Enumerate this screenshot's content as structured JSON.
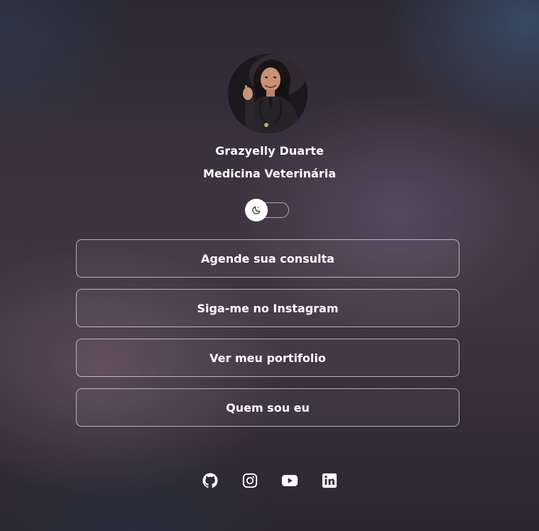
{
  "profile": {
    "name": "Grazyelly Duarte",
    "role": "Medicina Veterinária"
  },
  "theme_toggle": {
    "icon": "moon-icon",
    "state": "dark"
  },
  "links": [
    {
      "label": "Agende sua consulta"
    },
    {
      "label": "Siga-me no Instagram"
    },
    {
      "label": "Ver meu portifolio"
    },
    {
      "label": "Quem sou eu"
    }
  ],
  "socials": [
    {
      "icon": "github-icon"
    },
    {
      "icon": "instagram-icon"
    },
    {
      "icon": "youtube-icon"
    },
    {
      "icon": "linkedin-icon"
    }
  ],
  "colors": {
    "text": "#ffffff",
    "button_border": "#c9c4cc",
    "background": "#3a3240"
  }
}
